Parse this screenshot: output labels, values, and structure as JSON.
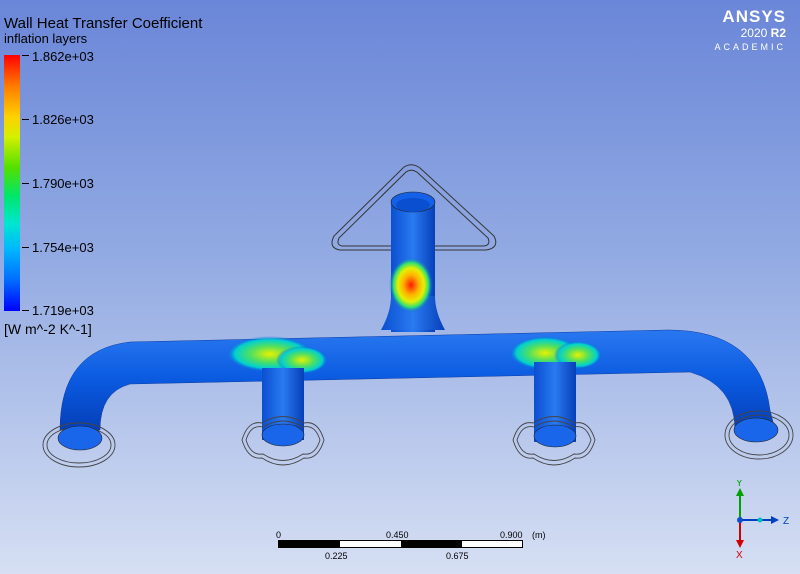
{
  "legend": {
    "title": "Wall Heat Transfer Coefficient",
    "subtitle": "inflation layers",
    "values": [
      "1.862e+03",
      "1.826e+03",
      "1.790e+03",
      "1.754e+03",
      "1.719e+03"
    ],
    "units": "[W m^-2 K^-1]",
    "colors": {
      "max": "#ff0000",
      "min": "#0000ff"
    }
  },
  "logo": {
    "brand": "ANSYS",
    "version": "2020",
    "release": "R2",
    "edition": "ACADEMIC"
  },
  "scale_bar": {
    "top_labels": [
      "0",
      "0.450",
      "0.900"
    ],
    "unit": "(m)",
    "bottom_labels": [
      "0.225",
      "0.675"
    ]
  },
  "axes": {
    "y": "Y",
    "z": "Z",
    "x": "X"
  },
  "model": {
    "name": "manifold-geometry",
    "colors": {
      "body": "#0a5ae0",
      "hot": "#ff2000"
    }
  }
}
